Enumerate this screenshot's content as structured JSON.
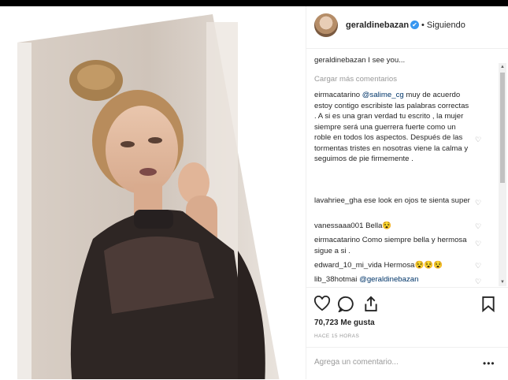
{
  "post": {
    "username": "geraldinebazan",
    "follow_status": "Siguiendo",
    "separator": "•",
    "verified_badge": "✔",
    "caption": {
      "username": "geraldinebazan",
      "text": "I see you..."
    },
    "load_more": "Cargar más comentarios",
    "comments": [
      {
        "username": "eirmacatarino",
        "mention": "@salime_cg",
        "text": " muy de acuerdo estoy contigo escribiste las palabras correctas . A si es una gran verdad tu escrito , la mujer siempre será una guerrera fuerte como un roble en todos los aspectos. Después de las tormentas tristes en nosotras viene la calma y seguimos de pie firmemente ."
      },
      {
        "username": "lavahriee_gha",
        "mention": "",
        "text": " ese look en ojos te sienta super"
      },
      {
        "username": "vanessaaa001",
        "mention": "",
        "text": " Bella😵"
      },
      {
        "username": "eirmacatarino",
        "mention": "",
        "text": " Como siempre bella y hermosa sigue a si ."
      },
      {
        "username": "edward_10_mi_vida",
        "mention": "",
        "text": " Hermosa😵😵😵"
      },
      {
        "username": "lib_38hotmai",
        "mention": "@geraldinebazan",
        "text": ""
      }
    ],
    "likes": "70,723 Me gusta",
    "timestamp": "HACE 15 HORAS",
    "add_comment_placeholder": "Agrega un comentario...",
    "more_options": "•••"
  },
  "icons": [
    "heart-icon",
    "comment-icon",
    "share-icon",
    "bookmark-icon",
    "verified-icon"
  ],
  "colors": {
    "link": "#003569",
    "muted": "#999999",
    "border": "#efefef",
    "verified": "#3897f0"
  }
}
